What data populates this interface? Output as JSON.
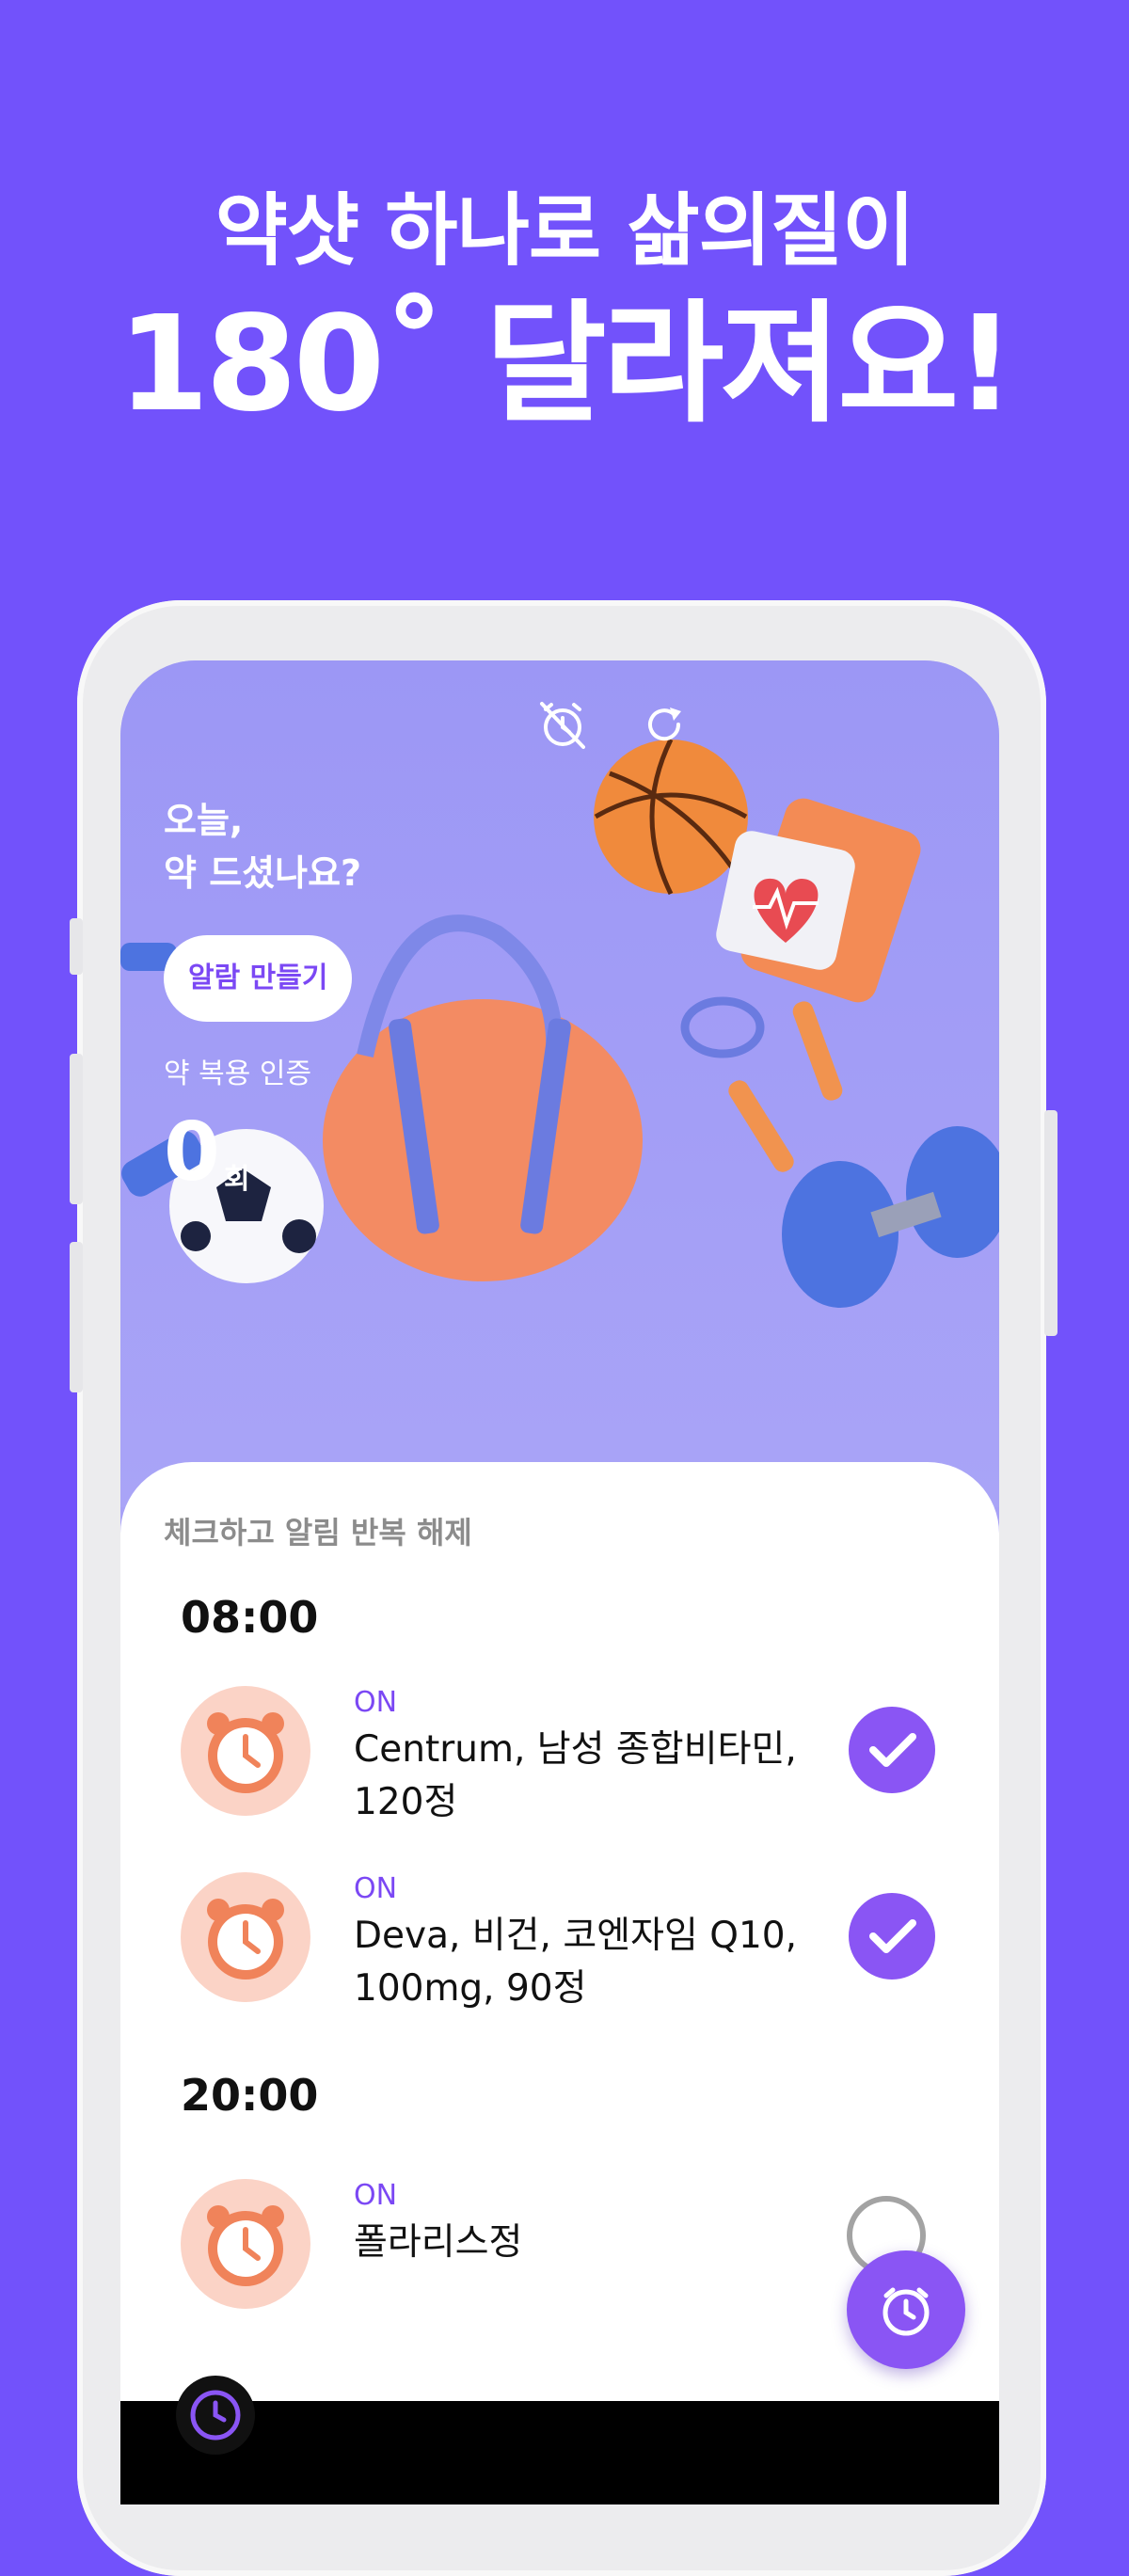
{
  "headline": {
    "line1": "약샷 하나로 삶의질이",
    "line2": "180˚ 달라져요!"
  },
  "hero": {
    "greeting_line1": "오늘,",
    "greeting_line2": "약 드셨나요?",
    "make_alarm_label": "알람 만들기",
    "cert_label": "약 복용 인증",
    "cert_count": "0",
    "cert_unit": "회",
    "icons": [
      "alarm-off-icon",
      "refresh-icon"
    ]
  },
  "schedule": {
    "title": "체크하고 알림 반복 해제",
    "groups": [
      {
        "time": "08:00",
        "items": [
          {
            "status": "ON",
            "name": "Centrum, 남성 종합비타민, 120정",
            "checked": true
          },
          {
            "status": "ON",
            "name": "Deva, 비건, 코엔자임 Q10, 100mg, 90정",
            "checked": true
          }
        ]
      },
      {
        "time": "20:00",
        "items": [
          {
            "status": "ON",
            "name": "폴라리스정",
            "checked": false
          }
        ]
      }
    ]
  },
  "colors": {
    "background": "#7252fb",
    "accent": "#8a55f4",
    "hero": "#a7a1f7"
  }
}
